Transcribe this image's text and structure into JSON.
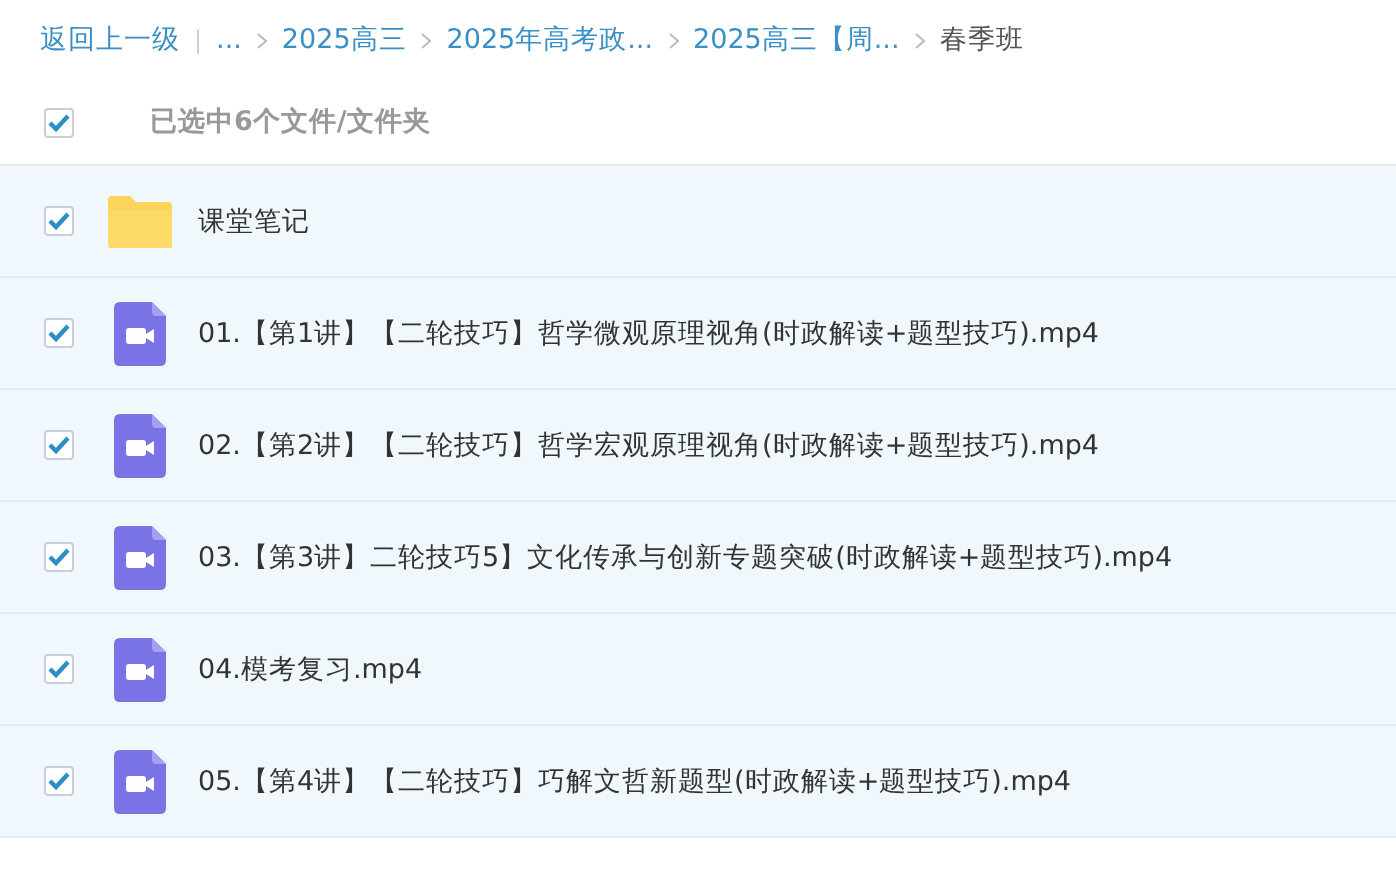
{
  "breadcrumb": {
    "back": "返回上一级",
    "separator": "|",
    "items": [
      {
        "label": "...",
        "current": false
      },
      {
        "label": "2025高三",
        "current": false
      },
      {
        "label": "2025年高考政...",
        "current": false
      },
      {
        "label": "2025高三【周...",
        "current": false
      },
      {
        "label": "春季班",
        "current": true
      }
    ]
  },
  "selection": {
    "checked": true,
    "label": "已选中6个文件/文件夹"
  },
  "files": [
    {
      "kind": "folder",
      "name": "课堂笔记",
      "selected": true
    },
    {
      "kind": "video",
      "name": "01.【第1讲】【二轮技巧】哲学微观原理视角(时政解读+题型技巧).mp4",
      "selected": true
    },
    {
      "kind": "video",
      "name": "02.【第2讲】【二轮技巧】哲学宏观原理视角(时政解读+题型技巧).mp4",
      "selected": true
    },
    {
      "kind": "video",
      "name": "03.【第3讲】二轮技巧5】文化传承与创新专题突破(时政解读+题型技巧).mp4",
      "selected": true
    },
    {
      "kind": "video",
      "name": "04.模考复习.mp4",
      "selected": true
    },
    {
      "kind": "video",
      "name": "05.【第4讲】【二轮技巧】巧解文哲新题型(时政解读+题型技巧).mp4",
      "selected": true
    }
  ]
}
